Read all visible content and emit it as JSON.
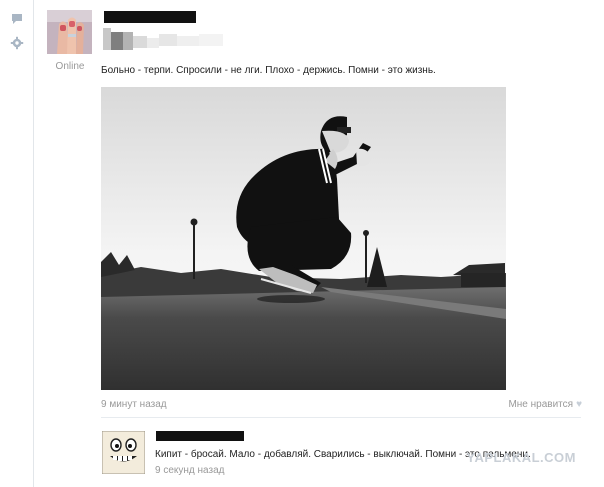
{
  "sidebar": {
    "icons": [
      "comment-icon",
      "gear-icon"
    ]
  },
  "post": {
    "online_label": "Online",
    "text": "Больно - терпи. Спросили - не лги. Плохо - держись. Помни - это жизнь.",
    "time": "9 минут назад",
    "like_label": "Мне нравится",
    "like_icon": "heart-icon"
  },
  "comment": {
    "text": "Кипит - бросай. Мало - добавляй. Сварились - выключай. Помни - это пельмени.",
    "time": "9 секунд назад"
  },
  "watermark": "YAPLAKAL.COM",
  "colors": {
    "muted_text": "#999999",
    "body_text": "#222222",
    "divider": "#e7ebef"
  }
}
